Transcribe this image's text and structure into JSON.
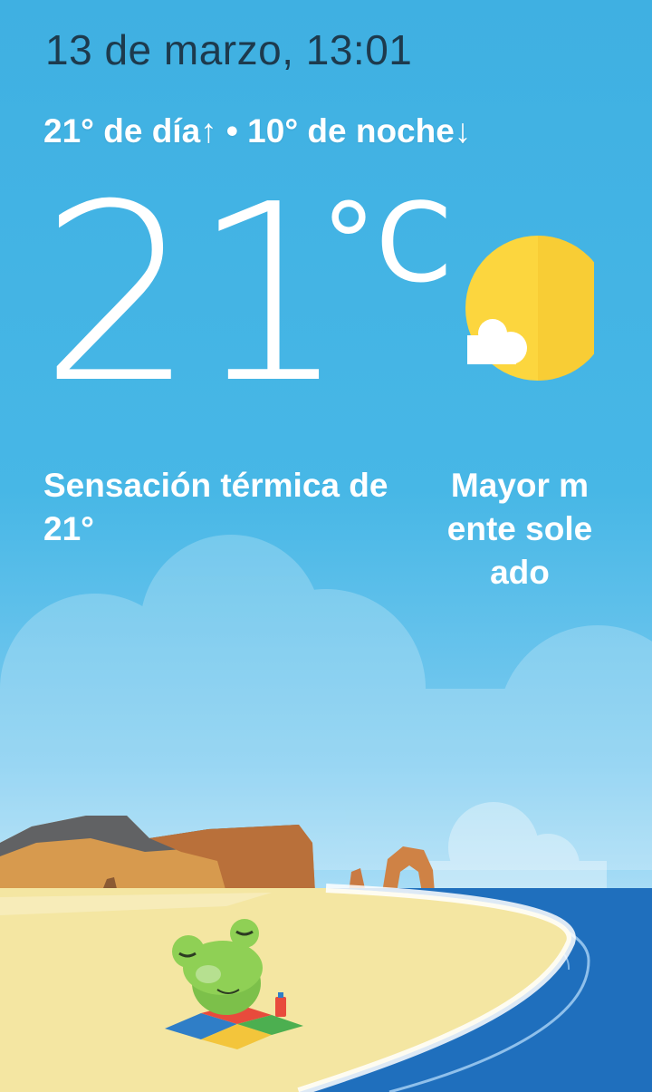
{
  "header": {
    "datetime": "13 de marzo, 13:01"
  },
  "forecast": {
    "range_text": "21° de día↑ • 10° de noche↓"
  },
  "current": {
    "temperature": "21",
    "unit": "°C",
    "feels_like": "Sensación térmica de 21°",
    "condition": "Mayor mente soleado",
    "icon": "partly-sunny-icon"
  },
  "colors": {
    "sky": "#47b7e6",
    "sun": "#fcd63e",
    "sea": "#1f6fbd",
    "sand": "#f4e6a2",
    "date_text": "#1d3a4d"
  }
}
